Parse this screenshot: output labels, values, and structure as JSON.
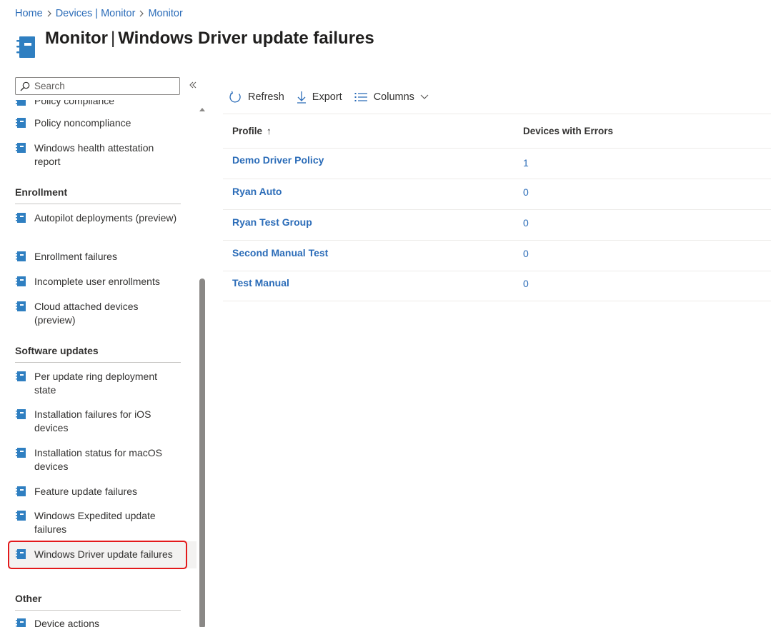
{
  "breadcrumb": [
    "Home",
    "Devices | Monitor",
    "Monitor"
  ],
  "title": {
    "main": "Monitor",
    "sub": "Windows Driver update failures"
  },
  "search": {
    "placeholder": "Search"
  },
  "nav": {
    "partial_item": "Policy compliance",
    "group1": [
      "Policy noncompliance",
      "Windows health attestation report"
    ],
    "enrollment": {
      "header": "Enrollment",
      "items": [
        "Autopilot deployments (preview)",
        "Enrollment failures",
        "Incomplete user enrollments",
        "Cloud attached devices (preview)"
      ]
    },
    "software_updates": {
      "header": "Software updates",
      "items": [
        "Per update ring deployment state",
        "Installation failures for iOS devices",
        "Installation status for macOS devices",
        "Feature update failures",
        "Windows Expedited update failures",
        "Windows Driver update failures"
      ]
    },
    "other": {
      "header": "Other",
      "items": [
        "Device actions"
      ]
    }
  },
  "toolbar": {
    "refresh": "Refresh",
    "export": "Export",
    "columns": "Columns"
  },
  "table": {
    "headers": {
      "profile": "Profile",
      "sort_arrow": "↑",
      "devices": "Devices with Errors"
    },
    "rows": [
      {
        "profile": "Demo Driver Policy",
        "count": "1"
      },
      {
        "profile": "Ryan Auto",
        "count": "0"
      },
      {
        "profile": "Ryan Test Group",
        "count": "0"
      },
      {
        "profile": "Second Manual Test",
        "count": "0"
      },
      {
        "profile": "Test Manual",
        "count": "0"
      }
    ]
  },
  "colors": {
    "link": "#2b6cb8",
    "highlight": "#e3191b",
    "icon": "#2f7fc1"
  }
}
